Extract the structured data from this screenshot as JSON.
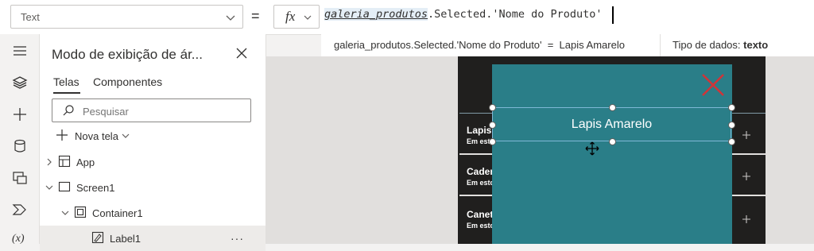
{
  "formula_bar": {
    "property": "Text",
    "fx_label": "fx",
    "formula_ident": "galeria_produtos",
    "formula_rest": ".Selected.'Nome do Produto'"
  },
  "hint": {
    "expression": "galeria_produtos.Selected.'Nome do Produto'  =  Lapis Amarelo",
    "type_label": "Tipo de dados: ",
    "type_value": "texto"
  },
  "rail": {
    "icons": [
      "hamburger-menu-icon",
      "layers-icon",
      "add-icon",
      "database-icon",
      "media-icon",
      "power-automate-icon",
      "variables-icon"
    ],
    "variables_label": "(x)"
  },
  "tree": {
    "title": "Modo de exibição de ár...",
    "tabs": [
      "Telas",
      "Componentes"
    ],
    "active_tab": "Telas",
    "search_placeholder": "Pesquisar",
    "new_screen": "Nova tela",
    "rows": [
      {
        "label": "App",
        "icon": "app-icon"
      },
      {
        "label": "Screen1",
        "icon": "screen-icon"
      },
      {
        "label": "Container1",
        "icon": "container-icon"
      },
      {
        "label": "Label1",
        "icon": "label-icon"
      }
    ],
    "more": "···"
  },
  "canvas": {
    "gallery_items": [
      {
        "title": "Lapis",
        "subtitle": "Em esto"
      },
      {
        "title": "Cader",
        "subtitle": "Em esto"
      },
      {
        "title": "Caneta",
        "subtitle": "Em esto"
      }
    ],
    "label_text": "Lapis Amarelo",
    "colors": {
      "popup": "#2a7e88",
      "close": "#d13438",
      "dark": "#201f1e"
    }
  }
}
